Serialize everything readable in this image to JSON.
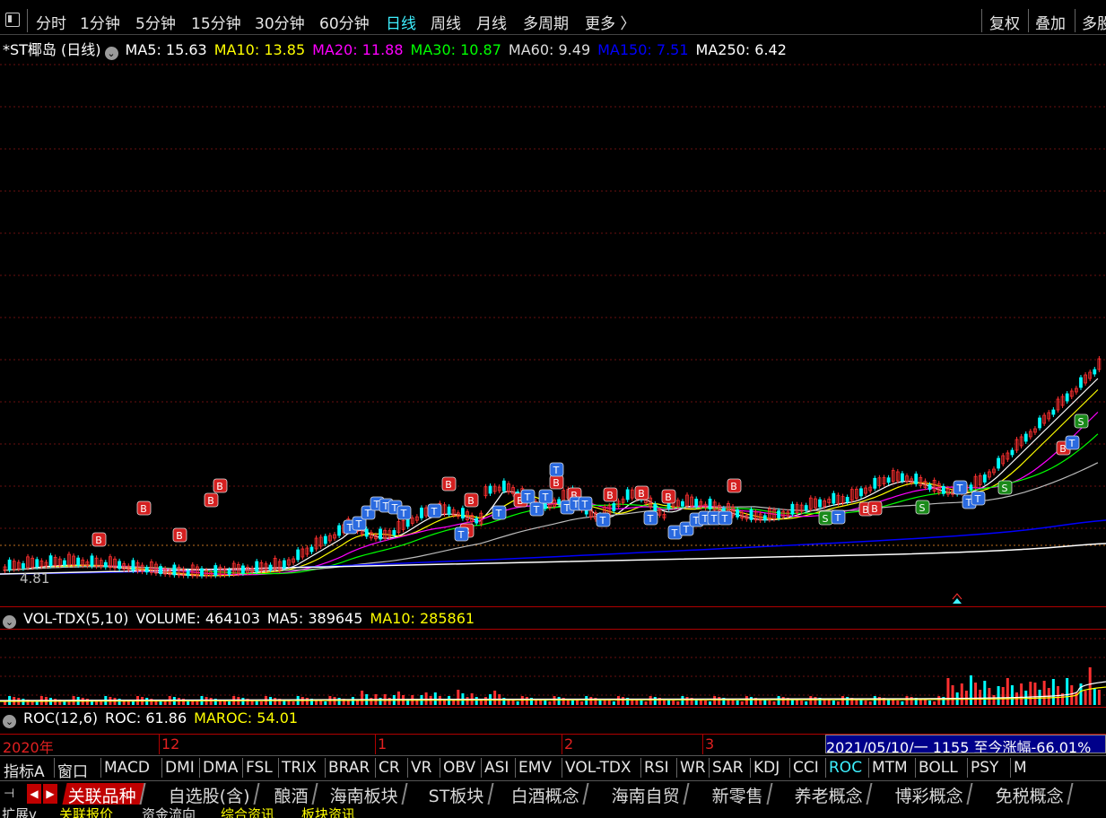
{
  "periods": [
    {
      "label": "分时"
    },
    {
      "label": "1分钟"
    },
    {
      "label": "5分钟"
    },
    {
      "label": "15分钟"
    },
    {
      "label": "30分钟"
    },
    {
      "label": "60分钟"
    },
    {
      "label": "日线",
      "active": true
    },
    {
      "label": "周线"
    },
    {
      "label": "月线"
    },
    {
      "label": "多周期"
    },
    {
      "label": "更多 〉"
    }
  ],
  "right_buttons": [
    "复权",
    "叠加",
    "多股"
  ],
  "main_legend": {
    "title": "*ST椰岛 (日线)",
    "ma": [
      {
        "text": "MA5: 15.63",
        "color": "#ffffff"
      },
      {
        "text": "MA10: 13.85",
        "color": "#ffff00"
      },
      {
        "text": "MA20: 11.88",
        "color": "#ff00ff"
      },
      {
        "text": "MA30: 10.87",
        "color": "#00ff00"
      },
      {
        "text": "MA60: 9.49",
        "color": "#dddddd"
      },
      {
        "text": "MA150: 7.51",
        "color": "#0000ff"
      },
      {
        "text": "MA250: 6.42",
        "color": "#ffffff"
      }
    ]
  },
  "low_price_label": "4.81",
  "volume_legend": {
    "name": "VOL-TDX(5,10)",
    "items": [
      {
        "text": "VOLUME: 464103",
        "color": "#ffffff"
      },
      {
        "text": "MA5: 389645",
        "color": "#ffffff"
      },
      {
        "text": "MA10: 285861",
        "color": "#ffff00"
      }
    ]
  },
  "roc_legend": {
    "name": "ROC(12,6)",
    "items": [
      {
        "text": "ROC: 61.86",
        "color": "#ffffff"
      },
      {
        "text": "MAROC: 54.01",
        "color": "#ffff00"
      }
    ]
  },
  "date_axis": {
    "labels": [
      "2020年",
      "12",
      "1",
      "2",
      "3"
    ],
    "range_text": "2021/05/10/一 1155 至今涨幅-66.01%"
  },
  "indicators": [
    "指标A",
    "窗口",
    "MACD",
    "DMI",
    "DMA",
    "FSL",
    "TRIX",
    "BRAR",
    "CR",
    "VR",
    "OBV",
    "ASI",
    "EMV",
    "VOL-TDX",
    "RSI",
    "WR",
    "SAR",
    "KDJ",
    "CCI",
    "ROC",
    "MTM",
    "BOLL",
    "PSY",
    "M"
  ],
  "active_indicator": "ROC",
  "blocks": [
    "关联品种",
    "自选股(含)",
    "酿酒",
    "海南板块",
    "ST板块",
    "白酒概念",
    "海南自贸",
    "新零售",
    "养老概念",
    "博彩概念",
    "免税概念"
  ],
  "active_block": "关联品种",
  "bottom_tabs": [
    {
      "label": "扩展v",
      "color": "#dddddd"
    },
    {
      "label": "关联报价",
      "color": "#ffff00"
    },
    {
      "label": "资金流向",
      "color": "#dddddd"
    },
    {
      "label": "综合资讯",
      "color": "#ffff00"
    },
    {
      "label": "板块资讯",
      "color": "#ffff00"
    }
  ],
  "markers": [
    {
      "label": "B",
      "kind": "buy"
    },
    {
      "label": "S",
      "kind": "sell"
    },
    {
      "label": "T",
      "kind": "t"
    }
  ],
  "colors": {
    "up": "#ff3030",
    "down": "#00ffff",
    "buy": "#d42020",
    "sell": "#1a8a1a",
    "t": "#2a6ae0",
    "grid": "#6a1010",
    "border": "#b00000"
  }
}
